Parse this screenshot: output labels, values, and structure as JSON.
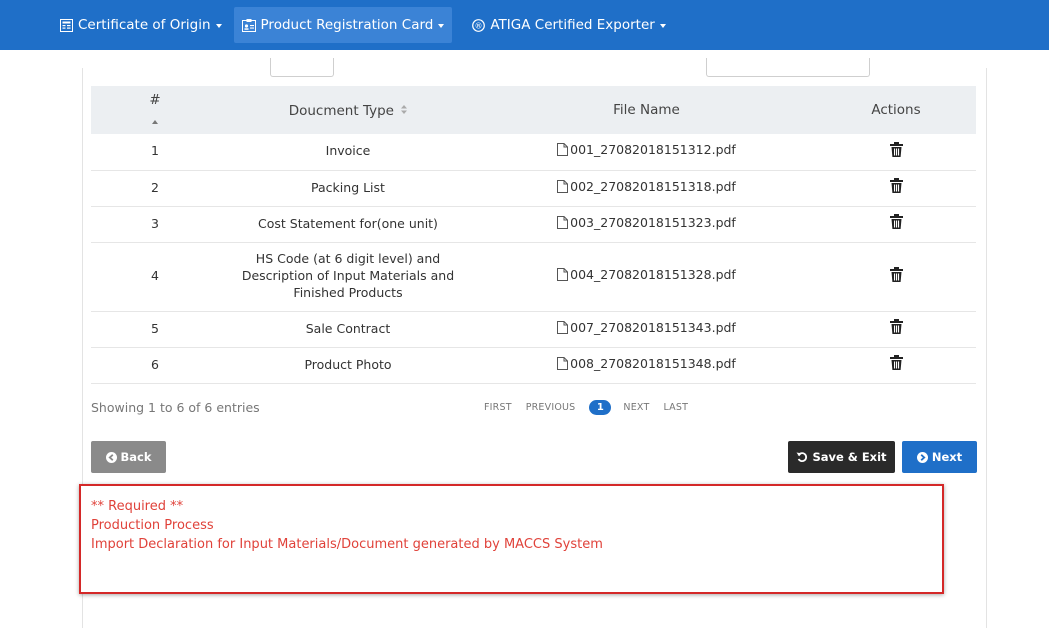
{
  "nav": {
    "items": [
      {
        "label": "Certificate of Origin",
        "icon": "certificate-icon"
      },
      {
        "label": "Product Registration Card",
        "icon": "id-card-icon"
      },
      {
        "label": "ATIGA Certified Exporter",
        "icon": "registered-icon"
      }
    ],
    "active_index": 1
  },
  "table": {
    "headers": {
      "num": "#",
      "doc_type": "Doucment Type",
      "file_name": "File Name",
      "actions": "Actions"
    },
    "rows": [
      {
        "num": "1",
        "doc_type": "Invoice",
        "file": "001_27082018151312.pdf"
      },
      {
        "num": "2",
        "doc_type": "Packing List",
        "file": "002_27082018151318.pdf"
      },
      {
        "num": "3",
        "doc_type": "Cost Statement for(one unit)",
        "file": "003_27082018151323.pdf"
      },
      {
        "num": "4",
        "doc_type": "HS Code (at 6 digit level) and Description of Input Materials and Finished Products",
        "file": "004_27082018151328.pdf"
      },
      {
        "num": "5",
        "doc_type": "Sale Contract",
        "file": "007_27082018151343.pdf"
      },
      {
        "num": "6",
        "doc_type": "Product Photo",
        "file": "008_27082018151348.pdf"
      }
    ],
    "info": "Showing 1 to 6 of 6 entries"
  },
  "pagination": {
    "first": "FIRST",
    "previous": "PREVIOUS",
    "current": "1",
    "next": "NEXT",
    "last": "LAST"
  },
  "buttons": {
    "back": "Back",
    "save_exit": "Save & Exit",
    "next": "Next"
  },
  "required": {
    "title": "** Required **",
    "items": [
      "Production Process",
      "Import Declaration for Input Materials/Document generated by MACCS System"
    ]
  },
  "colors": {
    "nav_bg": "#1f6fc8",
    "required_text": "#e0423a",
    "required_border": "#d42828"
  }
}
